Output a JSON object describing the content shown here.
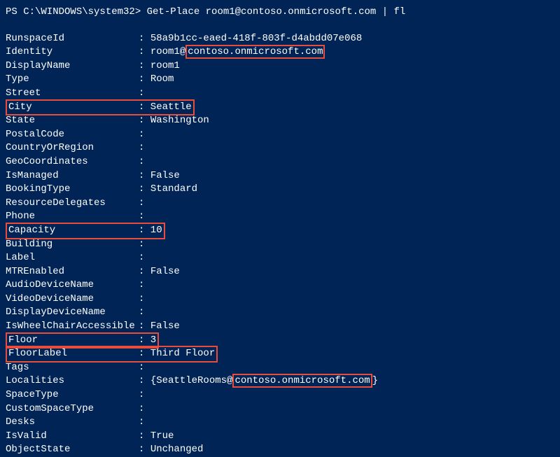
{
  "prompt": "PS C:\\WINDOWS\\system32> Get-Place room1@contoso.onmicrosoft.com | fl",
  "rows": [
    {
      "key": "RunspaceId",
      "value": "58a9b1cc-eaed-418f-803f-d4abdd07e068"
    },
    {
      "key": "Identity",
      "value_prefix": "room1@",
      "value_box": "contoso.onmicrosoft.com"
    },
    {
      "key": "DisplayName",
      "value": "room1"
    },
    {
      "key": "Type",
      "value": "Room"
    },
    {
      "key": "Street",
      "value": ""
    },
    {
      "key_boxed": true,
      "key": "City",
      "value_boxed_with_colon": true,
      "value": "Seattle"
    },
    {
      "key": "State",
      "value": "Washington"
    },
    {
      "key": "PostalCode",
      "value": ""
    },
    {
      "key": "CountryOrRegion",
      "value": ""
    },
    {
      "key": "GeoCoordinates",
      "value": ""
    },
    {
      "key": "IsManaged",
      "value": "False"
    },
    {
      "key": "BookingType",
      "value": "Standard"
    },
    {
      "key": "ResourceDelegates",
      "value": ""
    },
    {
      "key": "Phone",
      "value": ""
    },
    {
      "key_boxed": true,
      "key": "Capacity",
      "value_boxed_with_colon": true,
      "value": "10"
    },
    {
      "key": "Building",
      "value": ""
    },
    {
      "key": "Label",
      "value": ""
    },
    {
      "key": "MTREnabled",
      "value": "False"
    },
    {
      "key": "AudioDeviceName",
      "value": ""
    },
    {
      "key": "VideoDeviceName",
      "value": ""
    },
    {
      "key": "DisplayDeviceName",
      "value": ""
    },
    {
      "key": "IsWheelChairAccessible",
      "value": "False"
    },
    {
      "key_boxed": true,
      "key": "Floor",
      "value_boxed_with_colon": true,
      "value": "3",
      "group_top": true
    },
    {
      "key_boxed": true,
      "key": "FloorLabel",
      "value_boxed_with_colon": true,
      "value": "Third Floor",
      "group_bottom": true
    },
    {
      "key": "Tags",
      "value": ""
    },
    {
      "key": "Localities",
      "value_prefix": "{SeattleRooms@",
      "value_box": "contoso.onmicrosoft.com",
      "value_suffix": "}"
    },
    {
      "key": "SpaceType",
      "value": ""
    },
    {
      "key": "CustomSpaceType",
      "value": ""
    },
    {
      "key": "Desks",
      "value": ""
    },
    {
      "key": "IsValid",
      "value": "True"
    },
    {
      "key": "ObjectState",
      "value": "Unchanged"
    }
  ]
}
